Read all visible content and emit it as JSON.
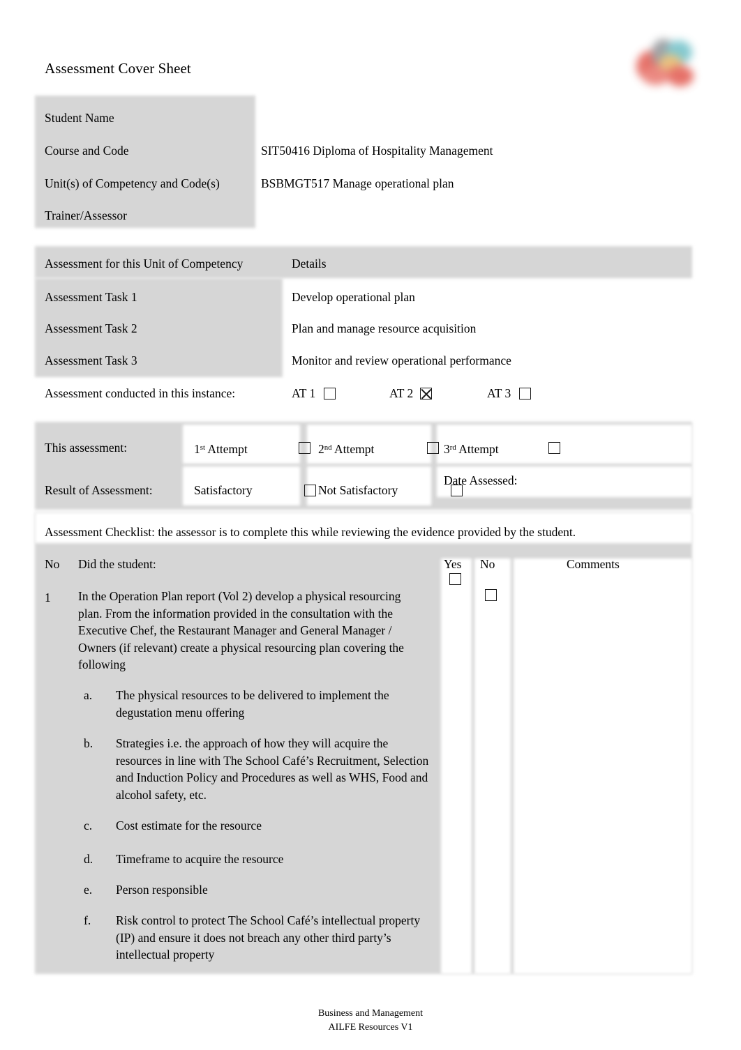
{
  "document": {
    "title": "Assessment Cover Sheet",
    "logo_icon": "ailfe-logo-icon"
  },
  "student_table": {
    "rows": [
      {
        "label": "Student Name",
        "value": ""
      },
      {
        "label": "Course and Code",
        "value": "SIT50416 Diploma of Hospitality Management"
      },
      {
        "label": "Unit(s) of Competency and Code(s)",
        "value": "BSBMGT517 Manage operational plan"
      },
      {
        "label": "Trainer/Assessor",
        "value": ""
      }
    ]
  },
  "assessment_table": {
    "header": {
      "col1": "Assessment for this Unit of Competency",
      "col2": "Details"
    },
    "rows": [
      {
        "label": "Assessment Task 1",
        "value": "Develop operational plan"
      },
      {
        "label": "Assessment Task 2",
        "value": "Plan and manage resource acquisition"
      },
      {
        "label": "Assessment Task 3",
        "value": "Monitor and review operational performance"
      }
    ],
    "conducted_label": "Assessment conducted in this instance:",
    "conducted_options": [
      {
        "label": "AT 1",
        "checked": false
      },
      {
        "label": "AT 2",
        "checked": true
      },
      {
        "label": "AT 3",
        "checked": false
      }
    ]
  },
  "result_table": {
    "attempt_label": "This assessment:",
    "attempts": [
      {
        "ordinal": "1",
        "suffix": "st",
        "label": "Attempt",
        "checked": false
      },
      {
        "ordinal": "2",
        "suffix": "nd",
        "label": "Attempt",
        "checked": false
      },
      {
        "ordinal": "3",
        "suffix": "rd",
        "label": "Attempt",
        "checked": false
      }
    ],
    "result_label": "Result of Assessment:",
    "results": [
      {
        "label": "Satisfactory",
        "checked": false
      },
      {
        "label": "Not Satisfactory",
        "checked": false
      }
    ],
    "date_label": "Date Assessed:",
    "date_value": ""
  },
  "checklist": {
    "note": "Assessment Checklist: the assessor is to complete this while reviewing the evidence provided by the student.",
    "headers": {
      "no": "No",
      "question": "Did the student:",
      "yes": "Yes",
      "no_col": "No",
      "comments": "Comments"
    },
    "items": [
      {
        "no": "1",
        "text": "In the Operation Plan report (Vol 2) develop a physical resourcing plan. From the information provided in the consultation with the Executive Chef, the Restaurant Manager and General Manager / Owners (if relevant) create a physical resourcing plan covering the following",
        "yes_checked": false,
        "no_checked": false,
        "comments": "",
        "sub_items": [
          {
            "mark": "a.",
            "text": "The physical resources to be delivered to implement the degustation menu offering"
          },
          {
            "mark": "b.",
            "text": "Strategies i.e. the approach of how they will acquire the resources in line with The School Café’s Recruitment, Selection and Induction Policy and Procedures as well as WHS, Food and alcohol safety, etc."
          },
          {
            "mark": "c.",
            "text": "Cost estimate for the resource"
          },
          {
            "mark": "d.",
            "text": "Timeframe to acquire the resource"
          },
          {
            "mark": "e.",
            "text": "Person responsible"
          },
          {
            "mark": "f.",
            "text": "Risk control to protect The School Café’s intellectual property (IP) and ensure it does not breach any other third party’s intellectual property"
          }
        ]
      }
    ]
  },
  "footer": {
    "line1": "Business and Management",
    "line2": "AILFE Resources V1"
  },
  "colors": {
    "shade": "#d6d6d6",
    "text": "#000000",
    "page": "#ffffff"
  }
}
